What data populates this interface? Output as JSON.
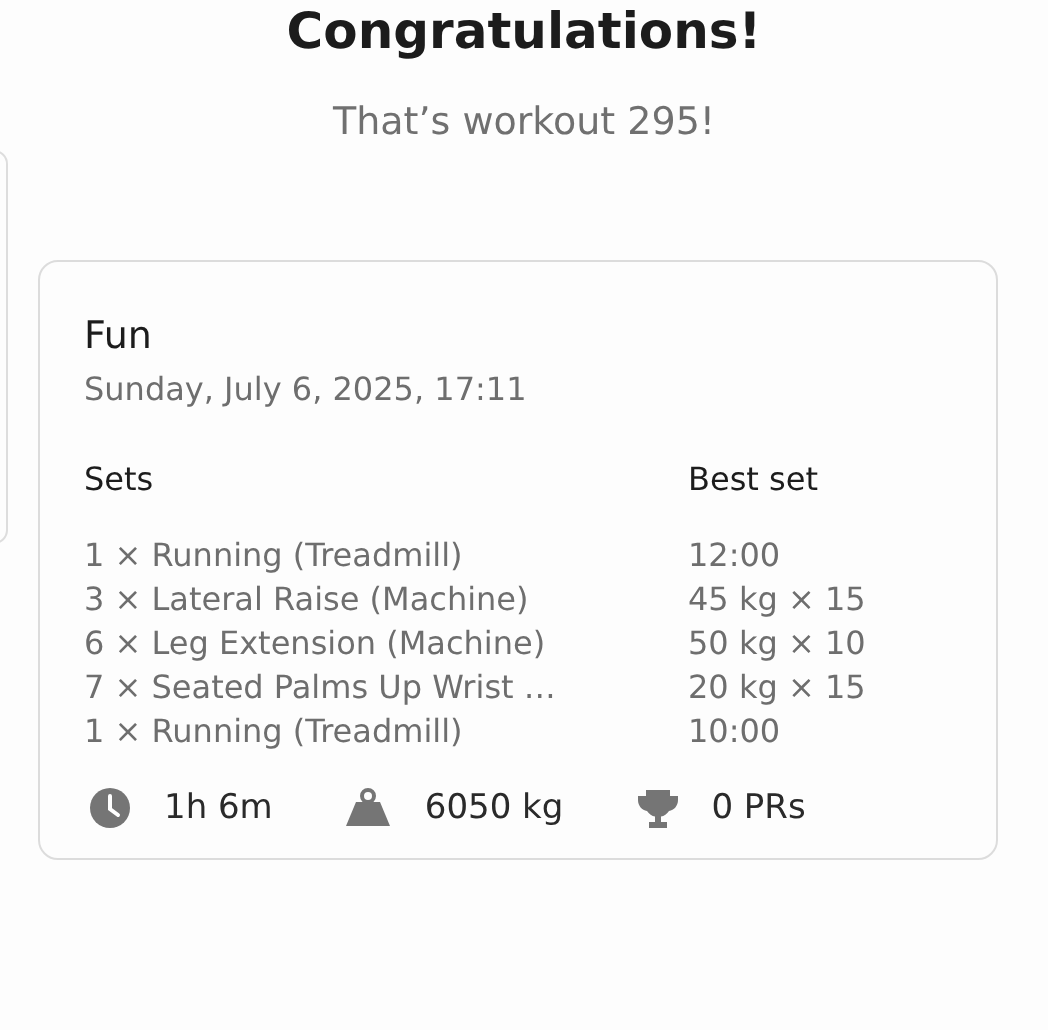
{
  "title": "Congratulations!",
  "subtitle": "That’s workout 295!",
  "workout": {
    "name": "Fun",
    "date": "Sunday, July 6, 2025, 17:11",
    "columns": [
      "Sets",
      "Best set"
    ],
    "rows": [
      {
        "exercise": "1 × Running (Treadmill)",
        "best_set": "12:00"
      },
      {
        "exercise": "3 × Lateral Raise (Machine)",
        "best_set": "45 kg × 15"
      },
      {
        "exercise": "6 × Leg Extension (Machine)",
        "best_set": "50 kg × 10"
      },
      {
        "exercise": "7 × Seated Palms Up Wrist …",
        "best_set": "20 kg × 15"
      },
      {
        "exercise": "1 × Running (Treadmill)",
        "best_set": "10:00"
      }
    ],
    "stats": [
      {
        "kind": "duration",
        "value": "1h 6m"
      },
      {
        "kind": "volume",
        "value": "6050 kg"
      },
      {
        "kind": "records",
        "value": "0 PRs"
      }
    ]
  }
}
